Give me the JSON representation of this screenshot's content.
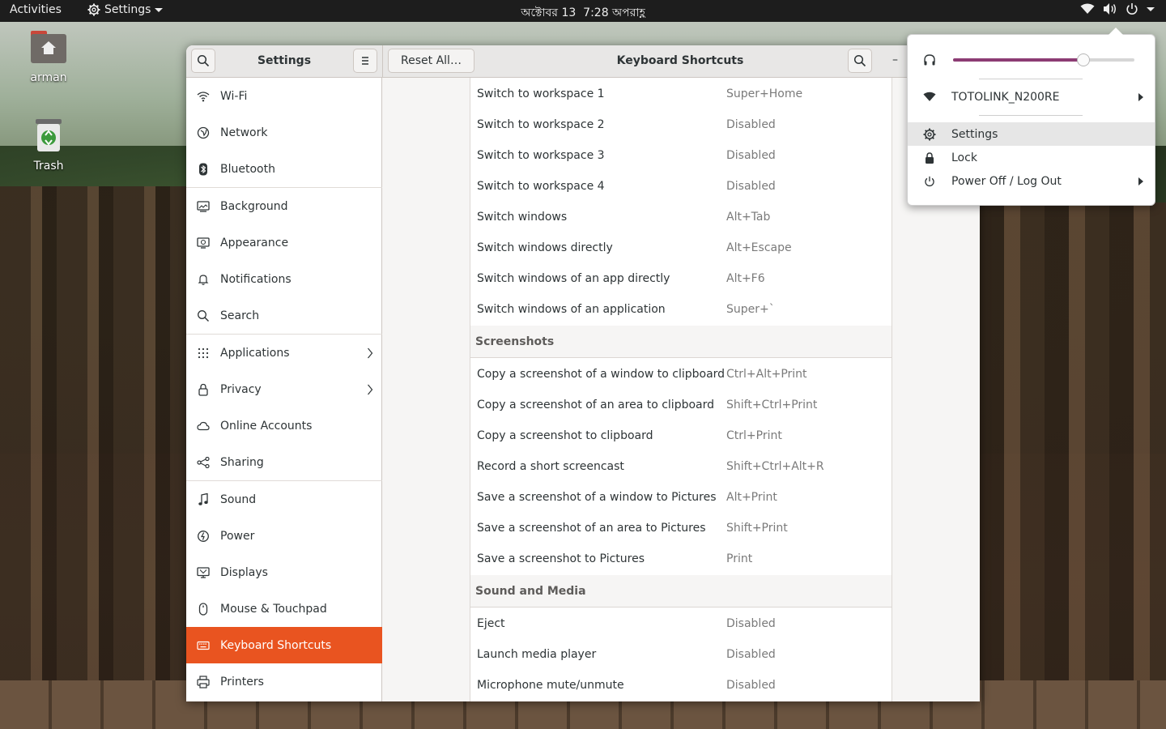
{
  "topbar": {
    "activities": "Activities",
    "app_menu": "Settings",
    "clock_date": "অক্টোবর 13",
    "clock_time": "7:28 অপরাহ্ণ"
  },
  "desktop": {
    "icons": [
      {
        "label": "arman",
        "icon": "home-folder-icon"
      },
      {
        "label": "Trash",
        "icon": "trash-icon"
      }
    ]
  },
  "window": {
    "sidebar_title": "Settings",
    "reset_label": "Reset All…",
    "title": "Keyboard Shortcuts",
    "minimize": "–"
  },
  "sidebar": {
    "items": [
      {
        "label": "Wi-Fi",
        "icon": "wifi-icon"
      },
      {
        "label": "Network",
        "icon": "network-icon"
      },
      {
        "label": "Bluetooth",
        "icon": "bluetooth-icon"
      },
      {
        "label": "Background",
        "icon": "background-icon"
      },
      {
        "label": "Appearance",
        "icon": "appearance-icon"
      },
      {
        "label": "Notifications",
        "icon": "bell-icon"
      },
      {
        "label": "Search",
        "icon": "search-icon"
      },
      {
        "label": "Applications",
        "icon": "grid-icon"
      },
      {
        "label": "Privacy",
        "icon": "lock-icon"
      },
      {
        "label": "Online Accounts",
        "icon": "cloud-icon"
      },
      {
        "label": "Sharing",
        "icon": "share-icon"
      },
      {
        "label": "Sound",
        "icon": "music-note-icon"
      },
      {
        "label": "Power",
        "icon": "power-icon"
      },
      {
        "label": "Displays",
        "icon": "display-icon"
      },
      {
        "label": "Mouse & Touchpad",
        "icon": "mouse-icon"
      },
      {
        "label": "Keyboard Shortcuts",
        "icon": "keyboard-icon"
      },
      {
        "label": "Printers",
        "icon": "printer-icon"
      }
    ],
    "active_index": 15
  },
  "shortcuts": {
    "group1": [
      {
        "name": "Switch to workspace 1",
        "accel": "Super+Home"
      },
      {
        "name": "Switch to workspace 2",
        "accel": "Disabled"
      },
      {
        "name": "Switch to workspace 3",
        "accel": "Disabled"
      },
      {
        "name": "Switch to workspace 4",
        "accel": "Disabled"
      },
      {
        "name": "Switch windows",
        "accel": "Alt+Tab"
      },
      {
        "name": "Switch windows directly",
        "accel": "Alt+Escape"
      },
      {
        "name": "Switch windows of an app directly",
        "accel": "Alt+F6"
      },
      {
        "name": "Switch windows of an application",
        "accel": "Super+`"
      }
    ],
    "screenshots_title": "Screenshots",
    "screenshots": [
      {
        "name": "Copy a screenshot of a window to clipboard",
        "accel": "Ctrl+Alt+Print"
      },
      {
        "name": "Copy a screenshot of an area to clipboard",
        "accel": "Shift+Ctrl+Print"
      },
      {
        "name": "Copy a screenshot to clipboard",
        "accel": "Ctrl+Print"
      },
      {
        "name": "Record a short screencast",
        "accel": "Shift+Ctrl+Alt+R"
      },
      {
        "name": "Save a screenshot of a window to Pictures",
        "accel": "Alt+Print"
      },
      {
        "name": "Save a screenshot of an area to Pictures",
        "accel": "Shift+Print"
      },
      {
        "name": "Save a screenshot to Pictures",
        "accel": "Print"
      }
    ],
    "media_title": "Sound and Media",
    "media": [
      {
        "name": "Eject",
        "accel": "Disabled"
      },
      {
        "name": "Launch media player",
        "accel": "Disabled"
      },
      {
        "name": "Microphone mute/unmute",
        "accel": "Disabled"
      }
    ]
  },
  "system_menu": {
    "volume_level": 0.72,
    "wifi_name": "TOTOLINK_N200RE",
    "settings": "Settings",
    "lock": "Lock",
    "power": "Power Off / Log Out"
  },
  "colors": {
    "accent": "#e95420",
    "volume": "#8c3c74",
    "topbar": "#1d1d1d"
  }
}
